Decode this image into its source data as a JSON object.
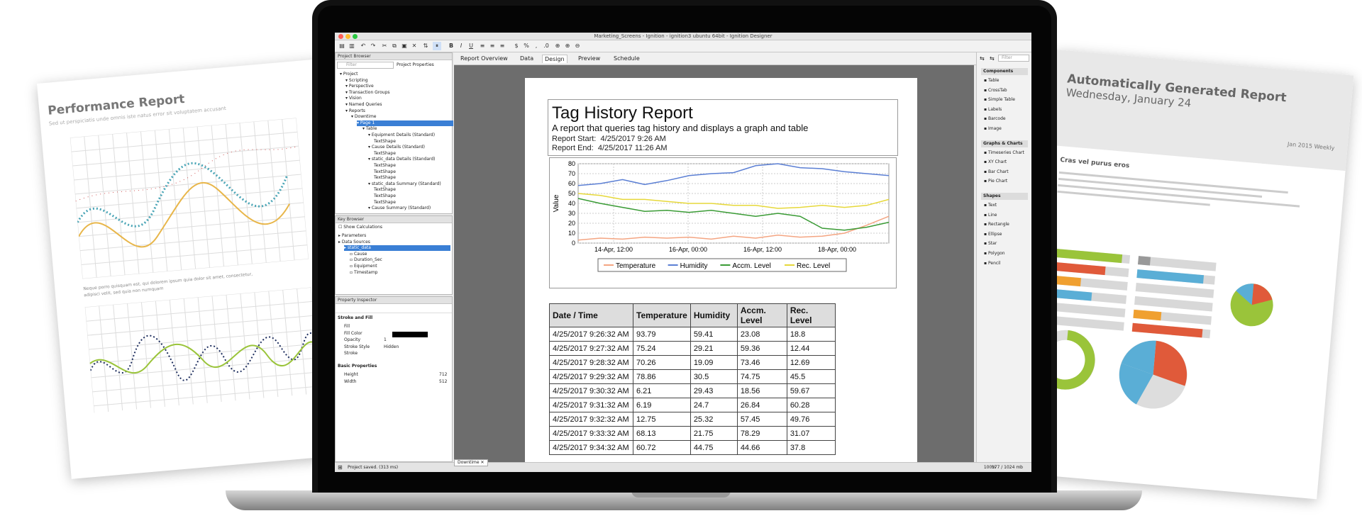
{
  "left_paper": {
    "title": "Performance Report",
    "subtitle": "Sed ut perspiciatis unde omnis iste natus error sit voluptatem accusant"
  },
  "right_paper": {
    "title": "Automatically Generated Report",
    "date": "Wednesday, January 24",
    "weekly": "Jan 2015 Weekly",
    "heading": "Cras vel purus eros"
  },
  "window": {
    "title": "Marketing_Screens - Ignition - ignition3 ubuntu 64bit - Ignition Designer"
  },
  "project_browser": {
    "title": "Project Browser",
    "filter_placeholder": "Filter",
    "properties_label": "Project Properties",
    "items": [
      "Project",
      "Scripting",
      "Perspective",
      "Transaction Groups",
      "Vision",
      "Named Queries",
      "Reports",
      "Downtime",
      "Page 1",
      "Table",
      "Equipment Details (Standard)",
      "TextShape",
      "Cause Details (Standard)",
      "TextShape",
      "static_data Details (Standard)",
      "TextShape",
      "TextShape",
      "TextShape",
      "static_data Summary (Standard)",
      "TextShape",
      "TextShape",
      "TextShape",
      "Cause Summary (Standard)"
    ]
  },
  "key_browser": {
    "title": "Key Browser",
    "show_calc": "Show Calculations",
    "items": [
      "Parameters",
      "Data Sources",
      "static_data",
      "Cause",
      "Duration_Sec",
      "Equipment",
      "Timestamp"
    ]
  },
  "property_inspector": {
    "title": "Property Inspector",
    "section1": "Stroke and Fill",
    "rows": [
      [
        "Fill",
        ""
      ],
      [
        "Fill Color",
        ""
      ],
      [
        "Opacity",
        "1"
      ],
      [
        "Stroke Style",
        "Hidden"
      ],
      [
        "Stroke",
        ""
      ]
    ],
    "section2": "Basic Properties",
    "rows2": [
      [
        "Height",
        "712"
      ],
      [
        "Width",
        "512"
      ]
    ]
  },
  "tabs": [
    "Report Overview",
    "Data",
    "Design",
    "Preview",
    "Schedule"
  ],
  "report": {
    "title": "Tag History Report",
    "subtitle": "A report that queries tag history and displays a graph and table",
    "start_label": "Report Start:",
    "start_value": "4/25/2017 9:26 AM",
    "end_label": "Report End:",
    "end_value": "4/25/2017 11:26 AM"
  },
  "chart_data": {
    "type": "line",
    "ylabel": "Value",
    "ylim": [
      0,
      80
    ],
    "yticks": [
      0,
      10,
      20,
      30,
      40,
      50,
      60,
      70,
      80
    ],
    "xticks": [
      "14-Apr, 12:00",
      "16-Apr, 00:00",
      "16-Apr, 12:00",
      "18-Apr, 00:00"
    ],
    "series": [
      {
        "name": "Temperature",
        "color": "#f4a582",
        "values": [
          3,
          5,
          4,
          6,
          5,
          6,
          4,
          7,
          5,
          8,
          6,
          7,
          10,
          18,
          27
        ]
      },
      {
        "name": "Humidity",
        "color": "#5b7fd4",
        "values": [
          58,
          60,
          64,
          59,
          63,
          68,
          70,
          71,
          78,
          80,
          76,
          75,
          72,
          70,
          68
        ]
      },
      {
        "name": "Accm. Level",
        "color": "#3a9b35",
        "values": [
          45,
          40,
          36,
          32,
          33,
          31,
          33,
          30,
          27,
          30,
          27,
          15,
          13,
          16,
          21
        ]
      },
      {
        "name": "Rec. Level",
        "color": "#e6d83a",
        "values": [
          50,
          48,
          44,
          44,
          42,
          40,
          40,
          38,
          38,
          35,
          36,
          38,
          36,
          38,
          44
        ]
      }
    ]
  },
  "table": {
    "headers": [
      "Date / Time",
      "Temperature",
      "Humidity",
      "Accm. Level",
      "Rec. Level"
    ],
    "rows": [
      [
        "4/25/2017 9:26:32 AM",
        "93.79",
        "59.41",
        "23.08",
        "18.8"
      ],
      [
        "4/25/2017 9:27:32 AM",
        "75.24",
        "29.21",
        "59.36",
        "12.44"
      ],
      [
        "4/25/2017 9:28:32 AM",
        "70.26",
        "19.09",
        "73.46",
        "12.69"
      ],
      [
        "4/25/2017 9:29:32 AM",
        "78.86",
        "30.5",
        "74.75",
        "45.5"
      ],
      [
        "4/25/2017 9:30:32 AM",
        "6.21",
        "29.43",
        "18.56",
        "59.67"
      ],
      [
        "4/25/2017 9:31:32 AM",
        "6.19",
        "24.7",
        "26.84",
        "60.28"
      ],
      [
        "4/25/2017 9:32:32 AM",
        "12.75",
        "25.32",
        "57.45",
        "49.76"
      ],
      [
        "4/25/2017 9:33:32 AM",
        "68.13",
        "21.75",
        "78.29",
        "31.07"
      ],
      [
        "4/25/2017 9:34:32 AM",
        "60.72",
        "44.75",
        "44.66",
        "37.8"
      ]
    ]
  },
  "palette": {
    "sections": [
      {
        "title": "Components",
        "items": [
          "Table",
          "CrossTab",
          "Simple Table",
          "Labels",
          "Barcode",
          "Image"
        ]
      },
      {
        "title": "Graphs & Charts",
        "items": [
          "Timeseries Chart",
          "XY Chart",
          "Bar Chart",
          "Pie Chart"
        ]
      },
      {
        "title": "Shapes",
        "items": [
          "Text",
          "Line",
          "Rectangle",
          "Ellipse",
          "Star",
          "Polygon",
          "Pencil"
        ]
      }
    ],
    "filter_placeholder": "Filter"
  },
  "status": {
    "message": "Project saved. (313 ms)",
    "doc_tab": "Downtime",
    "zoom": "100%",
    "memory": "177 / 1024 mb"
  }
}
